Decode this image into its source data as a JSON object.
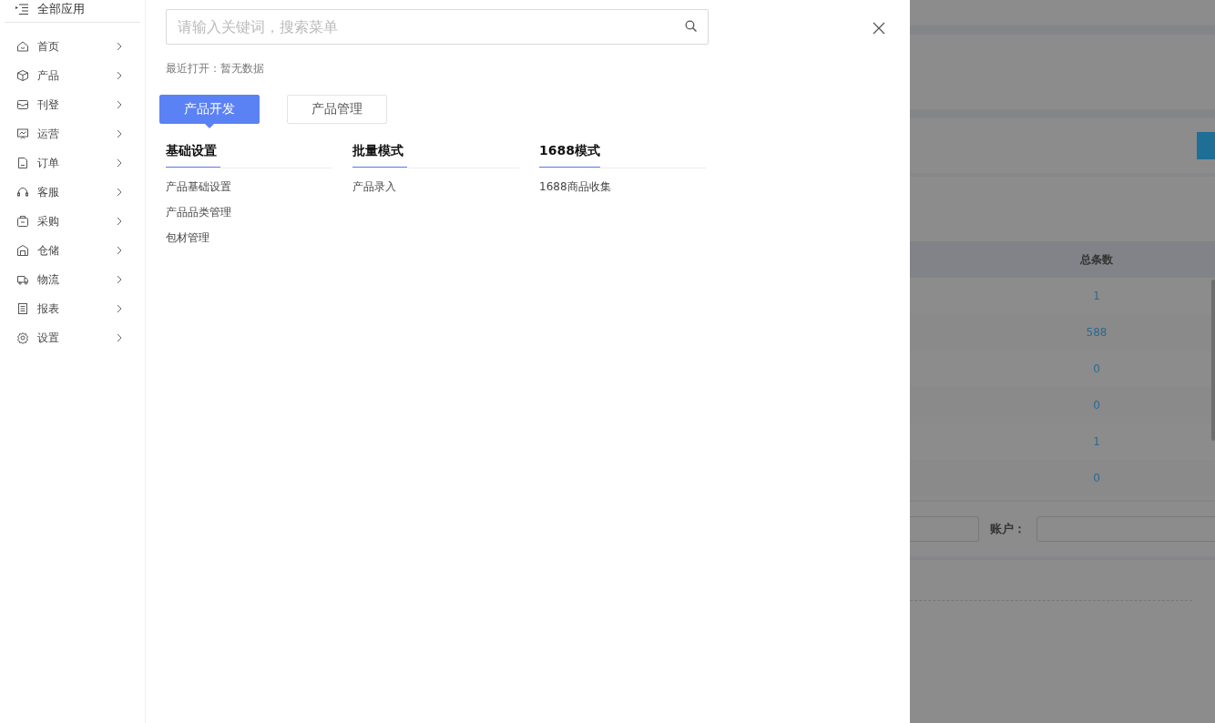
{
  "sidebar": {
    "header": "全部应用",
    "items": [
      {
        "label": "首页"
      },
      {
        "label": "产品"
      },
      {
        "label": "刊登"
      },
      {
        "label": "运营"
      },
      {
        "label": "订单"
      },
      {
        "label": "客服"
      },
      {
        "label": "采购"
      },
      {
        "label": "仓储"
      },
      {
        "label": "物流"
      },
      {
        "label": "报表"
      },
      {
        "label": "设置"
      }
    ]
  },
  "menu_panel": {
    "search": {
      "placeholder": "请输入关键词，搜索菜单"
    },
    "recent": "最近打开：暂无数据",
    "tabs": [
      {
        "label": "产品开发",
        "selected": true
      },
      {
        "label": "产品管理",
        "selected": false
      }
    ],
    "groups": [
      {
        "title": "基础设置",
        "items": [
          "产品基础设置",
          "产品品类管理",
          "包材管理"
        ]
      },
      {
        "title": "批量模式",
        "items": [
          "产品录入"
        ]
      },
      {
        "title": "1688模式",
        "items": [
          "1688商品收集"
        ]
      }
    ]
  },
  "background_page": {
    "table": {
      "columns": [
        "总条数"
      ],
      "rows": [
        "1",
        "588",
        "0",
        "0",
        "1",
        "0"
      ]
    },
    "filter": {
      "label": "账户："
    }
  }
}
